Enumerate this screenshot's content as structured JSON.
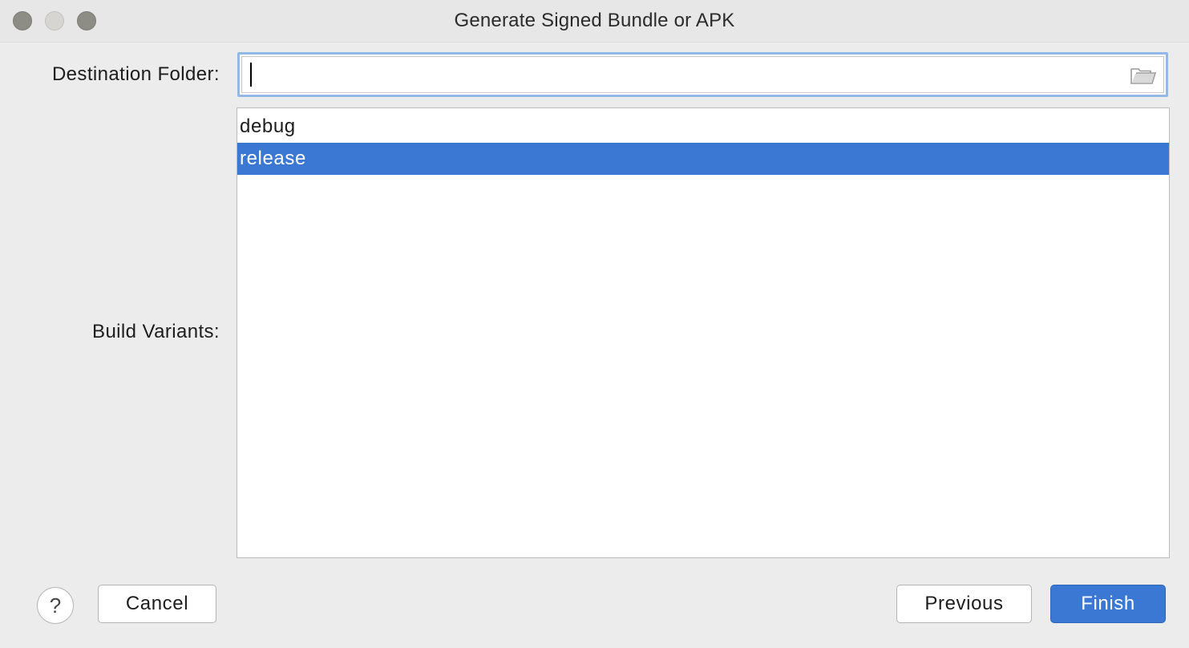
{
  "window": {
    "title": "Generate Signed Bundle or APK",
    "traffic_lights": [
      "close-button",
      "minimize-button",
      "zoom-button"
    ]
  },
  "form": {
    "destination_label": "Destination Folder:",
    "destination_value": "",
    "build_variants_label": "Build Variants:",
    "build_variants": [
      {
        "label": "debug",
        "selected": false
      },
      {
        "label": "release",
        "selected": true
      }
    ]
  },
  "footer": {
    "help_label": "?",
    "cancel_label": "Cancel",
    "previous_label": "Previous",
    "finish_label": "Finish"
  },
  "colors": {
    "selection": "#3b78d3",
    "focus_ring": "#92b8e8",
    "window_bg": "#ececec"
  },
  "icons": {
    "browse": "folder-icon",
    "help": "question-icon"
  }
}
